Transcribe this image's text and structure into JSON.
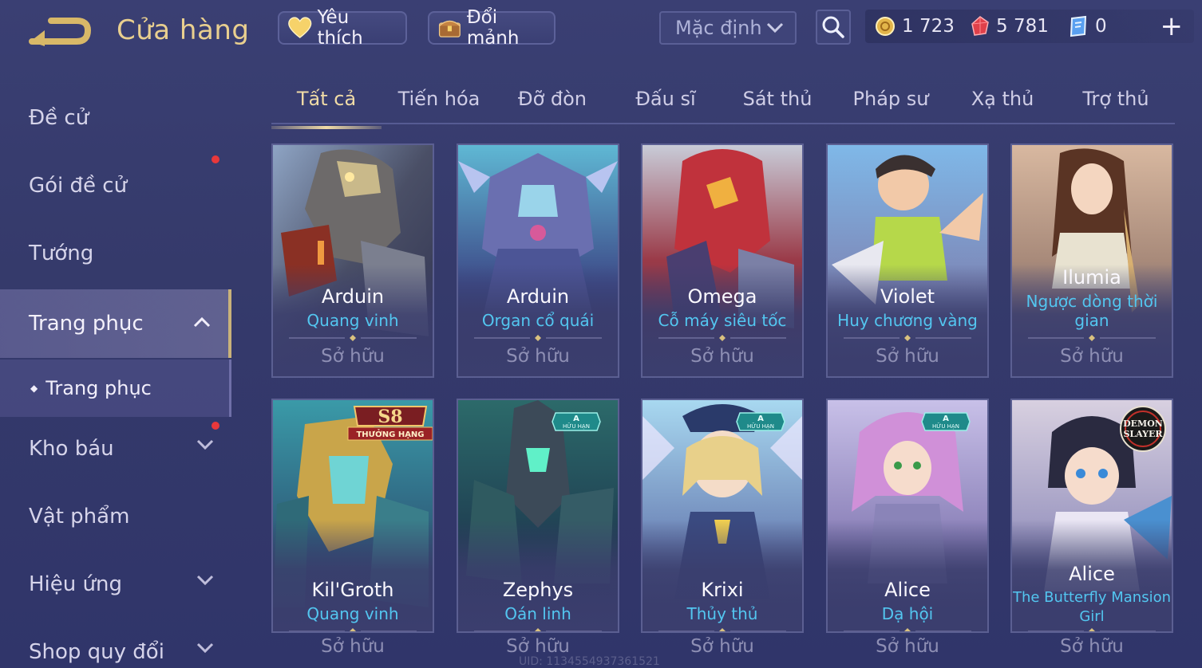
{
  "header": {
    "title": "Cửa hàng",
    "favorites_label": "Yêu thích",
    "shards_label": "Đổi mảnh",
    "sort": {
      "selected": "Mặc định"
    },
    "currencies": {
      "gold": "1 723",
      "ruby": "5 781",
      "voucher": "0"
    }
  },
  "sidebar": {
    "items": [
      {
        "label": "Đề cử"
      },
      {
        "label": "Gói đề cử"
      },
      {
        "label": "Tướng"
      },
      {
        "label": "Trang phục"
      },
      {
        "label": "Trang phục"
      },
      {
        "label": "Kho báu"
      },
      {
        "label": "Vật phẩm"
      },
      {
        "label": "Hiệu ứng"
      },
      {
        "label": "Shop quy đổi"
      }
    ]
  },
  "tabs": [
    {
      "label": "Tất cả"
    },
    {
      "label": "Tiến hóa"
    },
    {
      "label": "Đỡ đòn"
    },
    {
      "label": "Đấu sĩ"
    },
    {
      "label": "Sát thủ"
    },
    {
      "label": "Pháp sư"
    },
    {
      "label": "Xạ thủ"
    },
    {
      "label": "Trợ thủ"
    }
  ],
  "cards": [
    {
      "hero": "Arduin",
      "skin": "Quang vinh",
      "status": "Sở hữu"
    },
    {
      "hero": "Arduin",
      "skin": "Organ cổ quái",
      "status": "Sở hữu"
    },
    {
      "hero": "Omega",
      "skin": "Cỗ máy siêu tốc",
      "status": "Sở hữu"
    },
    {
      "hero": "Violet",
      "skin": "Huy chương vàng",
      "status": "Sở hữu"
    },
    {
      "hero": "Ilumia",
      "skin": "Ngược dòng thời gian",
      "status": "Sở hữu"
    },
    {
      "hero": "Kil'Groth",
      "skin": "Quang vinh",
      "status": "Sở hữu",
      "badge": "S8",
      "badge_text": "THƯỞNG HẠNG"
    },
    {
      "hero": "Zephys",
      "skin": "Oán linh",
      "status": "Sở hữu",
      "badge": "A",
      "badge_text": "HỮU HẠN"
    },
    {
      "hero": "Krixi",
      "skin": "Thủy thủ",
      "status": "Sở hữu",
      "badge": "A",
      "badge_text": "HỮU HẠN"
    },
    {
      "hero": "Alice",
      "skin": "Dạ hội",
      "status": "Sở hữu",
      "badge": "A",
      "badge_text": "HỮU HẠN"
    },
    {
      "hero": "Alice",
      "skin": "The Butterfly Mansion Girl",
      "status": "Sở hữu",
      "badge": "DEMON SLAYER"
    }
  ],
  "footer": {
    "uid": "UID: 1134554937361521"
  },
  "colors": {
    "accent_gold": "#e9cf8f",
    "skin_name": "#53c6f0",
    "owned_text": "#8e8fb4",
    "notification": "#e8383b"
  }
}
